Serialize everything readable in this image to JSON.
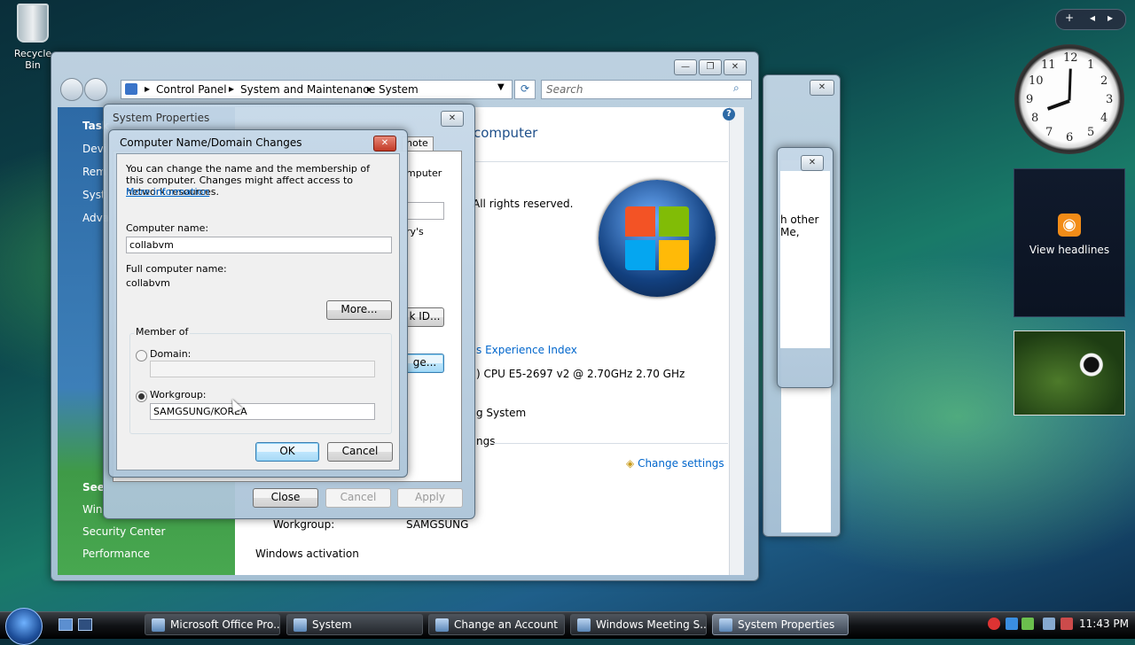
{
  "desktop": {
    "recycle_bin": "Recycle Bin"
  },
  "gadgets": {
    "rss_label": "View headlines",
    "clock_numbers": [
      "12",
      "1",
      "2",
      "3",
      "4",
      "5",
      "6",
      "7",
      "8",
      "9",
      "10",
      "11"
    ]
  },
  "system_window": {
    "breadcrumb": [
      "Control Panel",
      "System and Maintenance",
      "System"
    ],
    "search_placeholder": "Search",
    "tasks_heading": "Task",
    "tasks": [
      "Devi",
      "Rem",
      "Syst",
      "Adva"
    ],
    "see_also_heading": "See",
    "see_also": [
      "Win",
      "Security Center",
      "Performance"
    ],
    "heading_fragment": "computer",
    "rights": "All rights reserved.",
    "experience_index": "s Experience Index",
    "cpu": ") CPU E5-2697 v2 @ 2.70GHz   2.70 GHz",
    "os_fragment": "g System",
    "settings_fragment": "ngs",
    "change_settings": "Change settings",
    "workgroup_label": "Workgroup:",
    "workgroup_value": "SAMGSUNG",
    "activation": "Windows activation",
    "behind_text_1": "h other",
    "behind_text_2": "Me,"
  },
  "system_properties": {
    "title": "System Properties",
    "tab_fragment": "note",
    "computer_fragment": "mputer",
    "ys_fragment": "ry's",
    "network_id_fragment": "k ID...",
    "change_fragment": "ge...",
    "close": "Close",
    "cancel": "Cancel",
    "apply": "Apply"
  },
  "dialog": {
    "title": "Computer Name/Domain Changes",
    "description": "You can change the name and the membership of this computer. Changes might affect access to network resources.",
    "more_info": "More information",
    "computer_name_label": "Computer name:",
    "computer_name_value": "collabvm",
    "full_name_label": "Full computer name:",
    "full_name_value": "collabvm",
    "more_button": "More...",
    "member_of": "Member of",
    "domain_label": "Domain:",
    "domain_value": "",
    "workgroup_label": "Workgroup:",
    "workgroup_value": "SAMGSUNG/KOREA",
    "ok": "OK",
    "cancel": "Cancel"
  },
  "taskbar": {
    "items": [
      "Microsoft Office Pro...",
      "System",
      "Change an Account",
      "Windows Meeting S...",
      "System Properties"
    ],
    "time": "11:43 PM"
  },
  "colors": {
    "link": "#0066cc",
    "sidebar_green": "#3f9a47",
    "nav_blue": "#2d6aa6"
  }
}
